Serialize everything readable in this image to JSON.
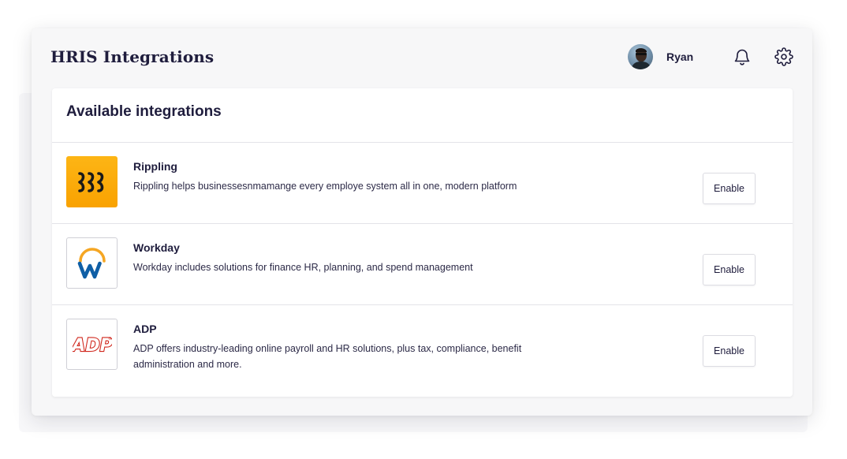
{
  "header": {
    "title": "HRIS Integrations",
    "user_name": "Ryan",
    "icons": [
      "bell-icon",
      "gear-icon"
    ]
  },
  "card": {
    "title": "Available integrations",
    "integrations": [
      {
        "name": "Rippling",
        "description": "Rippling helps businessesnmamange every employe system all in one, modern platform",
        "button_label": "Enable",
        "logo": "rippling-logo",
        "logo_color": "#fdb515"
      },
      {
        "name": "Workday",
        "description": "Workday includes solutions for finance HR, planning, and spend management",
        "button_label": "Enable",
        "logo": "workday-logo",
        "logo_color": "#0f5fa6"
      },
      {
        "name": "ADP",
        "description": "ADP offers industry-leading online payroll and HR solutions, plus tax, compliance, benefit administration and more.",
        "button_label": "Enable",
        "logo": "adp-logo",
        "logo_color": "#d0271d"
      }
    ]
  },
  "colors": {
    "text_primary": "#1f1d3d",
    "window_bg": "#f7f7f8",
    "card_bg": "#ffffff",
    "divider": "#e3e3e8"
  }
}
